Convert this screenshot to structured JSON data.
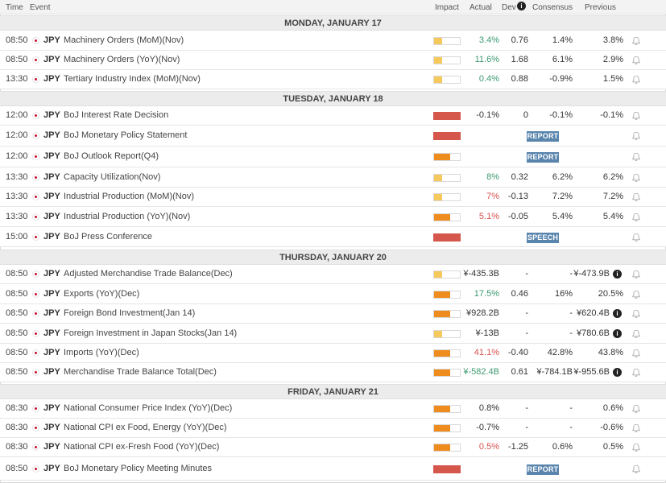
{
  "header": {
    "time": "Time",
    "event": "Event",
    "impact": "Impact",
    "actual": "Actual",
    "dev": "Dev",
    "dev_info": "i",
    "consensus": "Consensus",
    "previous": "Previous"
  },
  "colors": {
    "low_impact": "#f6c95c",
    "medium_impact": "#ee8d1e",
    "high_impact": "#d5574c",
    "positive": "#3d9970",
    "negative": "#d9534f",
    "tag_bg": "#5a85ad"
  },
  "days": [
    {
      "label": "MONDAY, JANUARY 17",
      "events": [
        {
          "time": "08:50",
          "currency": "JPY",
          "name": "Machinery Orders (MoM)(Nov)",
          "impact": "low",
          "actual": "3.4%",
          "actual_tone": "pos",
          "dev": "0.76",
          "consensus": "1.4%",
          "previous": "3.8%"
        },
        {
          "time": "08:50",
          "currency": "JPY",
          "name": "Machinery Orders (YoY)(Nov)",
          "impact": "low",
          "actual": "11.6%",
          "actual_tone": "pos",
          "dev": "1.68",
          "consensus": "6.1%",
          "previous": "2.9%"
        },
        {
          "time": "13:30",
          "currency": "JPY",
          "name": "Tertiary Industry Index (MoM)(Nov)",
          "impact": "low",
          "actual": "0.4%",
          "actual_tone": "pos",
          "dev": "0.88",
          "consensus": "-0.9%",
          "previous": "1.5%"
        }
      ]
    },
    {
      "label": "TUESDAY, JANUARY 18",
      "events": [
        {
          "time": "12:00",
          "currency": "JPY",
          "name": "BoJ Interest Rate Decision",
          "impact": "high",
          "actual": "-0.1%",
          "actual_tone": "neu",
          "dev": "0",
          "consensus": "-0.1%",
          "previous": "-0.1%"
        },
        {
          "time": "12:00",
          "currency": "JPY",
          "name": "BoJ Monetary Policy Statement",
          "impact": "high",
          "tag": "REPORT"
        },
        {
          "time": "12:00",
          "currency": "JPY",
          "name": "BoJ Outlook Report(Q4)",
          "impact": "med",
          "tag": "REPORT"
        },
        {
          "time": "13:30",
          "currency": "JPY",
          "name": "Capacity Utilization(Nov)",
          "impact": "low",
          "actual": "8%",
          "actual_tone": "pos",
          "dev": "0.32",
          "consensus": "6.2%",
          "previous": "6.2%"
        },
        {
          "time": "13:30",
          "currency": "JPY",
          "name": "Industrial Production (MoM)(Nov)",
          "impact": "low",
          "actual": "7%",
          "actual_tone": "neg",
          "dev": "-0.13",
          "consensus": "7.2%",
          "previous": "7.2%"
        },
        {
          "time": "13:30",
          "currency": "JPY",
          "name": "Industrial Production (YoY)(Nov)",
          "impact": "med",
          "actual": "5.1%",
          "actual_tone": "neg",
          "dev": "-0.05",
          "consensus": "5.4%",
          "previous": "5.4%"
        },
        {
          "time": "15:00",
          "currency": "JPY",
          "name": "BoJ Press Conference",
          "impact": "high",
          "tag": "SPEECH"
        }
      ]
    },
    {
      "label": "THURSDAY, JANUARY 20",
      "events": [
        {
          "time": "08:50",
          "currency": "JPY",
          "name": "Adjusted Merchandise Trade Balance(Dec)",
          "impact": "low",
          "actual": "¥-435.3B",
          "actual_tone": "neu",
          "dev": "-",
          "consensus": "-",
          "previous": "¥-473.9B",
          "prev_info": "i"
        },
        {
          "time": "08:50",
          "currency": "JPY",
          "name": "Exports (YoY)(Dec)",
          "impact": "med",
          "actual": "17.5%",
          "actual_tone": "pos",
          "dev": "0.46",
          "consensus": "16%",
          "previous": "20.5%"
        },
        {
          "time": "08:50",
          "currency": "JPY",
          "name": "Foreign Bond Investment(Jan 14)",
          "impact": "med",
          "actual": "¥928.2B",
          "actual_tone": "neu",
          "dev": "-",
          "consensus": "-",
          "previous": "¥620.4B",
          "prev_info": "i"
        },
        {
          "time": "08:50",
          "currency": "JPY",
          "name": "Foreign Investment in Japan Stocks(Jan 14)",
          "impact": "low",
          "actual": "¥-13B",
          "actual_tone": "neu",
          "dev": "-",
          "consensus": "-",
          "previous": "¥780.6B",
          "prev_info": "i"
        },
        {
          "time": "08:50",
          "currency": "JPY",
          "name": "Imports (YoY)(Dec)",
          "impact": "med",
          "actual": "41.1%",
          "actual_tone": "neg",
          "dev": "-0.40",
          "consensus": "42.8%",
          "previous": "43.8%"
        },
        {
          "time": "08:50",
          "currency": "JPY",
          "name": "Merchandise Trade Balance Total(Dec)",
          "impact": "med",
          "actual": "¥-582.4B",
          "actual_tone": "pos",
          "dev": "0.61",
          "consensus": "¥-784.1B",
          "previous": "¥-955.6B",
          "prev_info": "i"
        }
      ]
    },
    {
      "label": "FRIDAY, JANUARY 21",
      "events": [
        {
          "time": "08:30",
          "currency": "JPY",
          "name": "National Consumer Price Index (YoY)(Dec)",
          "impact": "med",
          "actual": "0.8%",
          "actual_tone": "neu",
          "dev": "-",
          "consensus": "-",
          "previous": "0.6%"
        },
        {
          "time": "08:30",
          "currency": "JPY",
          "name": "National CPI ex Food, Energy (YoY)(Dec)",
          "impact": "med",
          "actual": "-0.7%",
          "actual_tone": "neu",
          "dev": "-",
          "consensus": "-",
          "previous": "-0.6%"
        },
        {
          "time": "08:30",
          "currency": "JPY",
          "name": "National CPI ex-Fresh Food (YoY)(Dec)",
          "impact": "med",
          "actual": "0.5%",
          "actual_tone": "neg",
          "dev": "-1.25",
          "consensus": "0.6%",
          "previous": "0.5%"
        },
        {
          "time": "08:50",
          "currency": "JPY",
          "name": "BoJ Monetary Policy Meeting Minutes",
          "impact": "high",
          "tag": "REPORT"
        }
      ]
    }
  ]
}
